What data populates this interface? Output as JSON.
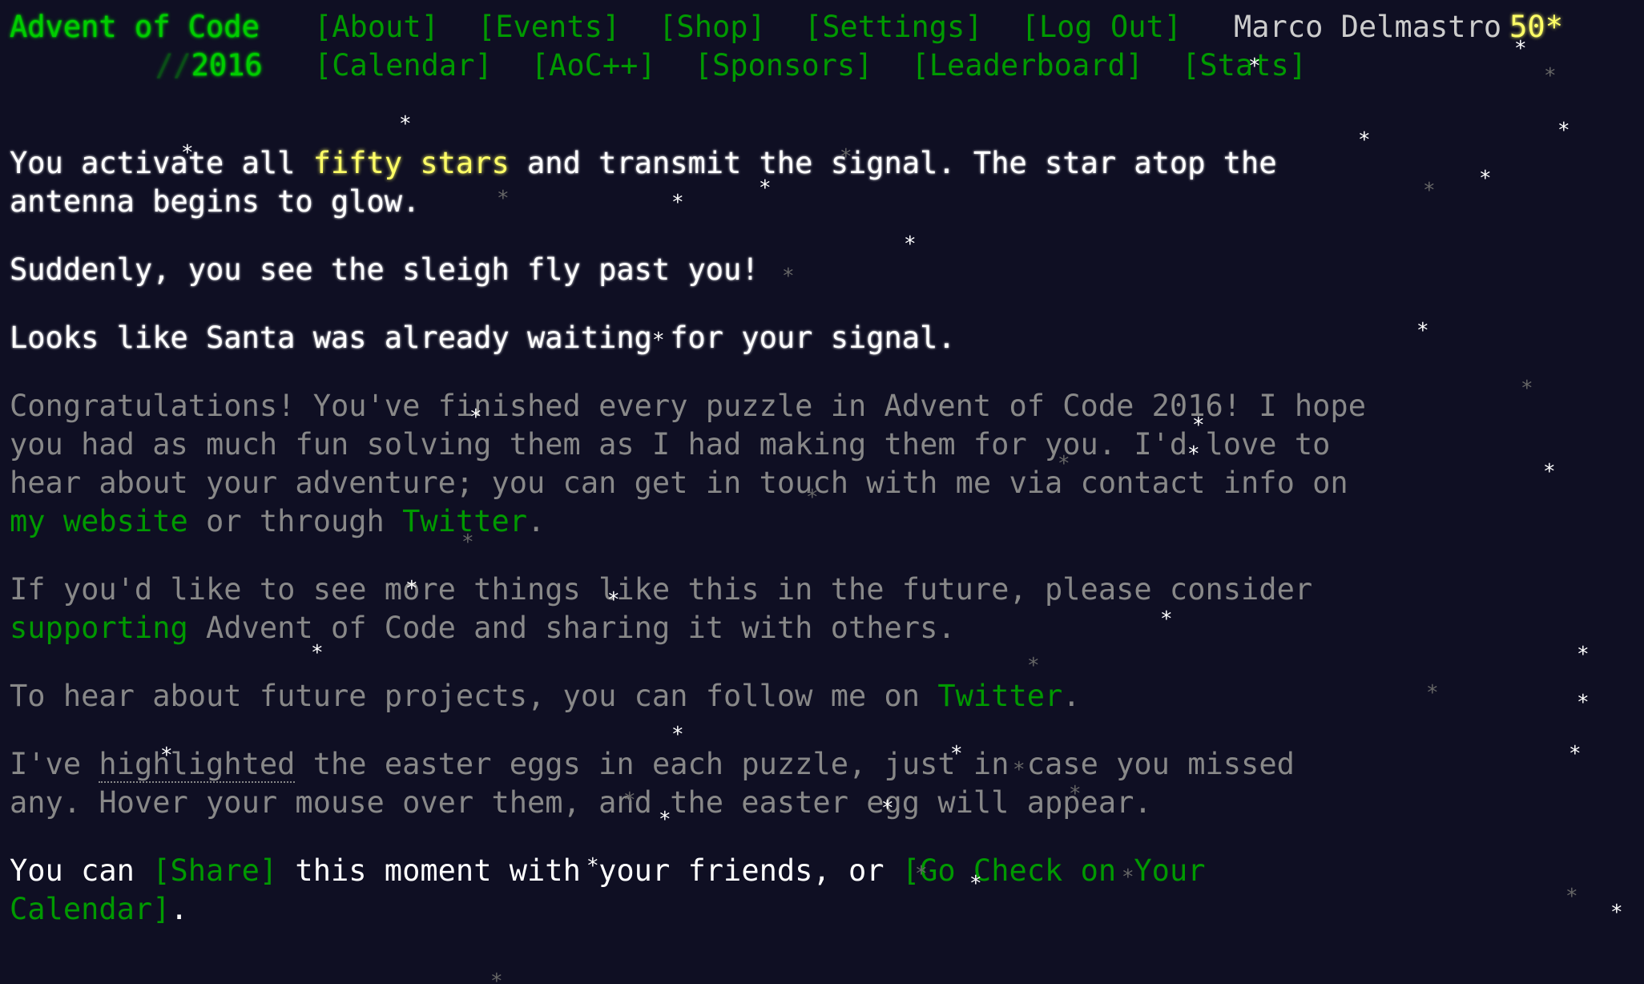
{
  "header": {
    "title": "Advent of Code",
    "year_prefix": "//",
    "year": "2016",
    "nav_row1": [
      "[About]",
      "[Events]",
      "[Shop]",
      "[Settings]",
      "[Log Out]"
    ],
    "nav_row2": [
      "[Calendar]",
      "[AoC++]",
      "[Sponsors]",
      "[Leaderboard]",
      "[Stats]"
    ],
    "user_name": "Marco Delmastro",
    "user_stars": "50*"
  },
  "main": {
    "p1_part1": "You activate all ",
    "p1_highlight": "fifty stars",
    "p1_part2": " and transmit the signal. The star atop the antenna begins to glow.",
    "p2": "Suddenly, you see the sleigh fly past you!",
    "p3": "Looks like Santa was already waiting for your signal.",
    "p4_part1": "Congratulations! You've finished every puzzle in Advent of Code 2016! I hope you had as much fun solving them as I had making them for you. I'd love to hear about your adventure; you can get in touch with me via contact info on ",
    "p4_link1": "my website",
    "p4_part2": " or through ",
    "p4_link2": "Twitter",
    "p4_part3": ".",
    "p5_part1": "If you'd like to see more things like this in the future, please consider ",
    "p5_link": "supporting",
    "p5_part2": " Advent of Code and sharing it with others.",
    "p6_part1": "To hear about future projects, you can follow me on ",
    "p6_link": "Twitter",
    "p6_part2": ".",
    "p7_part1": "I've ",
    "p7_highlight": "highlighted",
    "p7_part2": " the easter eggs in each puzzle, just in case you missed any. Hover your mouse over them, and the easter egg will appear.",
    "p8_part1": "You can ",
    "p8_share": "[Share]",
    "p8_part2": " this moment with your friends, or ",
    "p8_calendar": "[Go Check on Your Calendar]",
    "p8_part3": "."
  },
  "colors": {
    "background": "#0f0f23",
    "text": "#cccccc",
    "link_green": "#009900",
    "title_green": "#00cc00",
    "gold": "#ffff66",
    "dim": "#888888"
  },
  "decoration": {
    "star_glyph": "*"
  }
}
